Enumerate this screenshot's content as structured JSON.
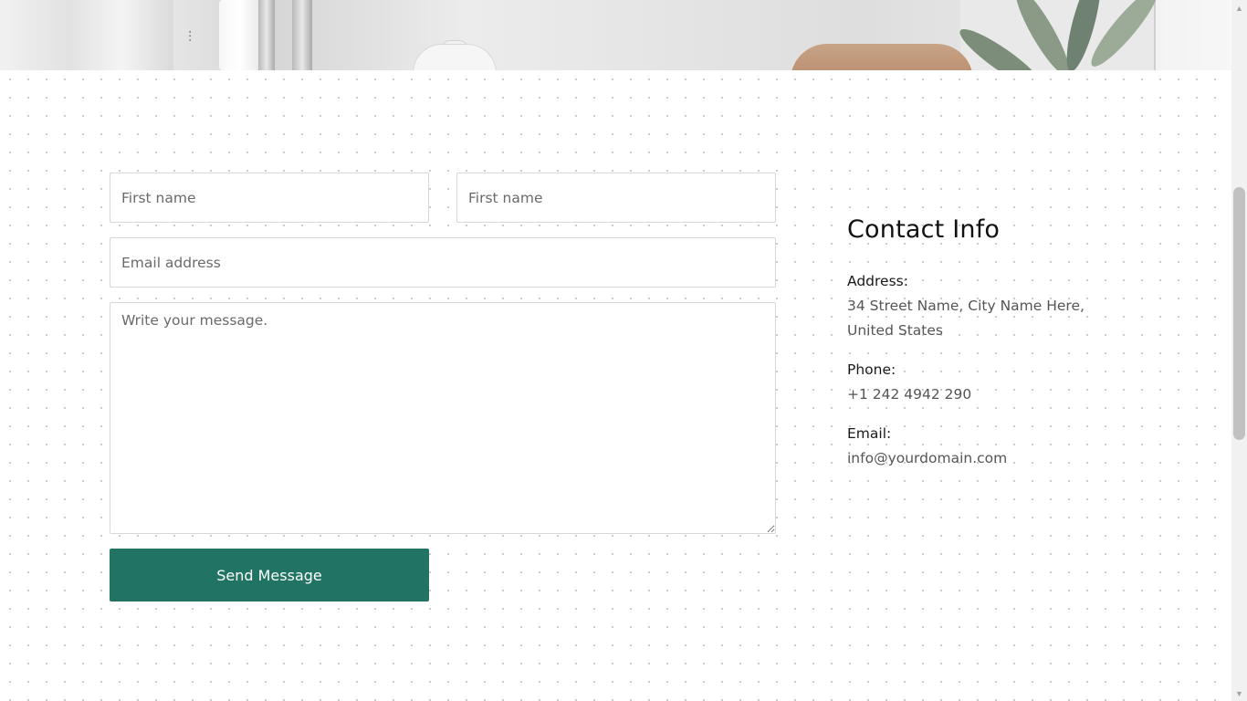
{
  "form": {
    "first_name_placeholder": "First name",
    "second_name_placeholder": "First name",
    "email_placeholder": "Email address",
    "message_placeholder": "Write your message.",
    "submit_label": "Send Message",
    "accent_color": "#217463"
  },
  "contact": {
    "title": "Contact Info",
    "address_label": "Address:",
    "address_line1": "34 Street Name, City Name Here,",
    "address_line2": "United States",
    "phone_label": "Phone:",
    "phone_value": "+1 242 4942 290",
    "email_label": "Email:",
    "email_value": "info@yourdomain.com"
  },
  "icons": {
    "scroll_up": "triangle-up-icon",
    "scroll_down": "triangle-down-icon"
  }
}
